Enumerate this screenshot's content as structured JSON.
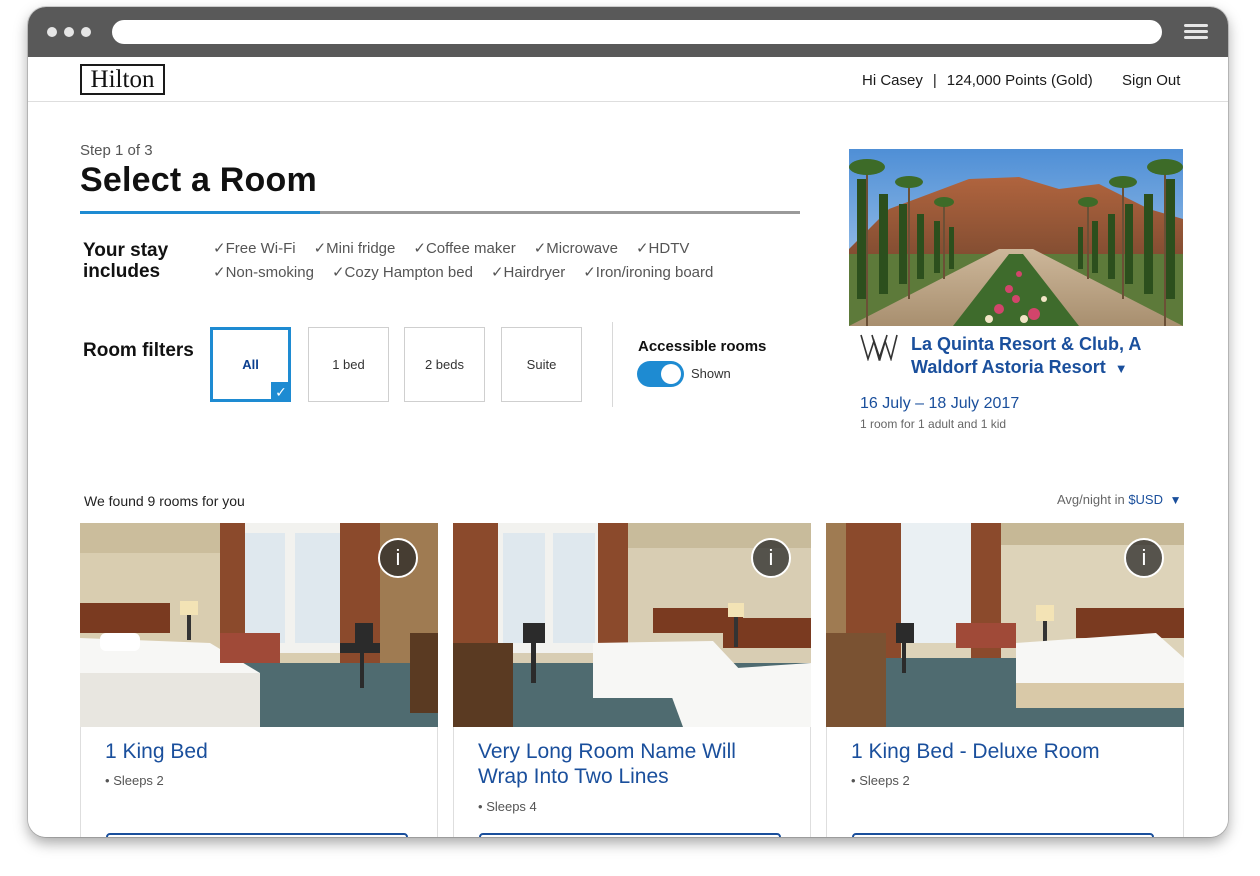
{
  "header": {
    "logo_text": "Hilton",
    "greeting": "Hi Casey",
    "separator": "|",
    "points": "124,000 Points (Gold)",
    "sign_out": "Sign Out"
  },
  "step": {
    "label": "Step 1 of 3",
    "title": "Select a Room",
    "progress_fraction": 0.333
  },
  "stay": {
    "label": "Your stay includes",
    "amenities_row1": [
      "Free Wi-Fi",
      "Mini fridge",
      "Coffee maker",
      "Microwave",
      "HDTV"
    ],
    "amenities_row2": [
      "Non-smoking",
      "Cozy Hampton bed",
      "Hairdryer",
      "Iron/ironing board"
    ],
    "check_glyph": "✓"
  },
  "filters": {
    "label": "Room filters",
    "options": [
      "All",
      "1 bed",
      "2 beds",
      "Suite"
    ],
    "selected": "All",
    "accessible_title": "Accessible rooms",
    "accessible_state": "Shown",
    "accessible_on": true
  },
  "hotel": {
    "name": "La Quinta Resort & Club, A Waldorf Astoria Resort",
    "dropdown_glyph": "▼",
    "dates": "16 July – 18 July 2017",
    "guests": "1 room for 1 adult and 1 kid"
  },
  "results": {
    "found_text": "We found 9 rooms for you",
    "avg_prefix": "Avg/night in ",
    "currency": "$USD",
    "currency_glyph": "▼"
  },
  "rooms": [
    {
      "name": "1 King Bed",
      "sleeps": "Sleeps 2"
    },
    {
      "name": "Very Long Room Name Will Wrap Into Two Lines",
      "sleeps": "Sleeps 4"
    },
    {
      "name": "1 King Bed - Deluxe Room",
      "sleeps": "Sleeps 2"
    }
  ],
  "icons": {
    "info": "i",
    "bullet": "•"
  },
  "colors": {
    "accent_blue": "#1e8bd2",
    "link_blue": "#1a4f9c",
    "browser_chrome": "#595959"
  }
}
